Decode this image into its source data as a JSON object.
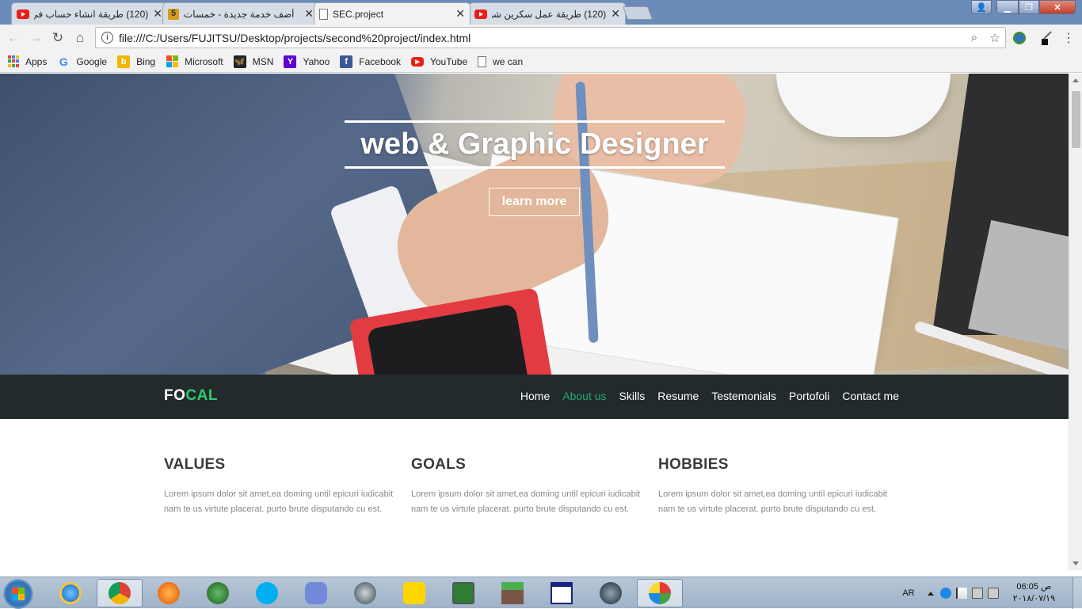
{
  "browser": {
    "tabs": [
      {
        "title": "(120) طريقة انشاء حساب في خمـ",
        "icon": "youtube-icon"
      },
      {
        "title": "أضف خدمة جديدة - خمسات",
        "icon": "khamsat-icon"
      },
      {
        "title": "SEC.project",
        "icon": "document-icon",
        "active": true
      },
      {
        "title": "(120) طريقة عمل سكرين شوت",
        "icon": "youtube-icon"
      }
    ],
    "url": "file:///C:/Users/FUJITSU/Desktop/projects/second%20project/index.html",
    "bookmarks": [
      {
        "label": "Apps",
        "icon": "apps-grid-icon"
      },
      {
        "label": "Google",
        "icon": "google-icon"
      },
      {
        "label": "Bing",
        "icon": "bing-icon"
      },
      {
        "label": "Microsoft",
        "icon": "microsoft-icon"
      },
      {
        "label": "MSN",
        "icon": "msn-icon"
      },
      {
        "label": "Yahoo",
        "icon": "yahoo-icon"
      },
      {
        "label": "Facebook",
        "icon": "facebook-icon"
      },
      {
        "label": "YouTube",
        "icon": "youtube-icon"
      },
      {
        "label": "we can",
        "icon": "document-icon"
      }
    ]
  },
  "page": {
    "hero": {
      "title": "web & Graphic Designer",
      "button": "learn more"
    },
    "navbar": {
      "brand_a": "FO",
      "brand_b": "CAL",
      "brand_accent": "#2fca6f",
      "links": [
        "Home",
        "About us",
        "Skills",
        "Resume",
        "Testemonials",
        "Portofoli",
        "Contact me"
      ],
      "active_link": "About us"
    },
    "sections": [
      {
        "heading": "VALUES",
        "text": "Lorem ipsum dolor sit amet,ea doming until epicuri iudicabit nam te us virtute placerat. purto brute disputando cu est."
      },
      {
        "heading": "GOALS",
        "text": "Lorem ipsum dolor sit amet,ea doming until epicuri iudicabit nam te us virtute placerat. purto brute disputando cu est."
      },
      {
        "heading": "HOBBIES",
        "text": "Lorem ipsum dolor sit amet,ea doming until epicuri iudicabit nam te us virtute placerat. purto brute disputando cu est."
      }
    ]
  },
  "taskbar": {
    "apps": [
      "internet-explorer-icon",
      "chrome-icon",
      "firefox-icon",
      "internet-download-manager-icon",
      "skype-icon",
      "discord-icon",
      "teamspeak-icon",
      "kmplayer-icon",
      "task-manager-icon",
      "minecraft-icon",
      "window-icon",
      "steam-icon",
      "paint-icon"
    ],
    "language": "AR",
    "time": "06:05 ص",
    "date": "٢٠١٨/٠٧/١٩"
  }
}
